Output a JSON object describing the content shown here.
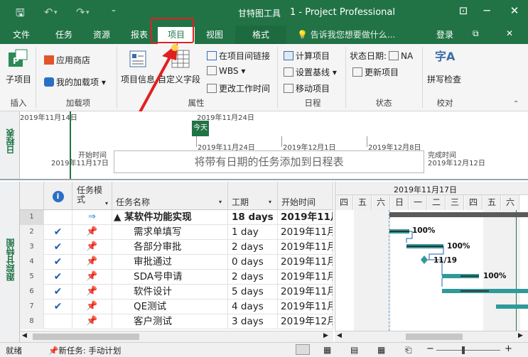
{
  "window": {
    "title": "1 - Project Professional",
    "tool_tab": "甘特图工具"
  },
  "colors": {
    "accent": "#217346",
    "highlight": "#e02020",
    "bar": "#2f9a9a",
    "summary": "#5b5b5b"
  },
  "tabs": [
    "文件",
    "任务",
    "资源",
    "报表",
    "项目",
    "视图",
    "格式"
  ],
  "tellme": "告诉我您想要做什么...",
  "login": "登录",
  "ribbon": {
    "subproject": "子项目",
    "app_store": "应用商店",
    "my_addins": "我的加载项",
    "project_info": "项目信息",
    "custom_fields": "自定义字段",
    "links_between": "在项目间链接",
    "wbs": "WBS",
    "change_work_time": "更改工作时间",
    "calc_project": "计算项目",
    "set_baseline": "设置基线",
    "move_project": "移动项目",
    "status_date_label": "状态日期:",
    "status_date_value": "NA",
    "update_project": "更新项目",
    "spell_check": "拼写检查",
    "groups": {
      "insert": "插入",
      "addins": "加载项",
      "properties": "属性",
      "schedule": "日程",
      "status": "状态",
      "proofing": "校对"
    }
  },
  "timeline": {
    "side_label": "日程表",
    "top_dates": [
      "2019年11月14日",
      "2019年11月24日"
    ],
    "today_marker": "今天",
    "scale_dates": [
      "2019年11月24日",
      "2019年12月1日",
      "2019年12月8日"
    ],
    "start_label": "开始时间",
    "start_date": "2019年11月17日",
    "finish_label": "完成时间",
    "finish_date": "2019年12月12日",
    "drop_text": "将带有日期的任务添加到日程表"
  },
  "gantt_side_label": "跟踪甘特图",
  "grid": {
    "headers": {
      "mode": "任务模式",
      "name": "任务名称",
      "duration": "工期",
      "start": "开始时间"
    },
    "rows": [
      {
        "id": "1",
        "name": "▲ 某软件功能实现",
        "duration": "18 days",
        "start": "2019年11月",
        "done": false,
        "summary": true
      },
      {
        "id": "2",
        "name": "需求单填写",
        "duration": "1 day",
        "start": "2019年11月",
        "done": true
      },
      {
        "id": "3",
        "name": "各部分审批",
        "duration": "2 days",
        "start": "2019年11月",
        "done": true
      },
      {
        "id": "4",
        "name": "审批通过",
        "duration": "0 days",
        "start": "2019年11月",
        "done": true
      },
      {
        "id": "5",
        "name": "SDA号申请",
        "duration": "2 days",
        "start": "2019年11月",
        "done": true
      },
      {
        "id": "6",
        "name": "软件设计",
        "duration": "5 days",
        "start": "2019年11月",
        "done": true
      },
      {
        "id": "7",
        "name": "QE测试",
        "duration": "4 days",
        "start": "2019年11月",
        "done": true
      },
      {
        "id": "8",
        "name": "客户测试",
        "duration": "3 days",
        "start": "2019年12月",
        "done": false
      }
    ]
  },
  "chart": {
    "week_label": "2019年11月17日",
    "days": [
      "四",
      "五",
      "六",
      "日",
      "一",
      "二",
      "三",
      "四",
      "五",
      "六"
    ],
    "labels": {
      "r2": "100%",
      "r3": "100%",
      "r4": "11/19",
      "r5": "100%"
    }
  },
  "status": {
    "ready": "就绪",
    "new_task": "新任务: 手动计划"
  }
}
